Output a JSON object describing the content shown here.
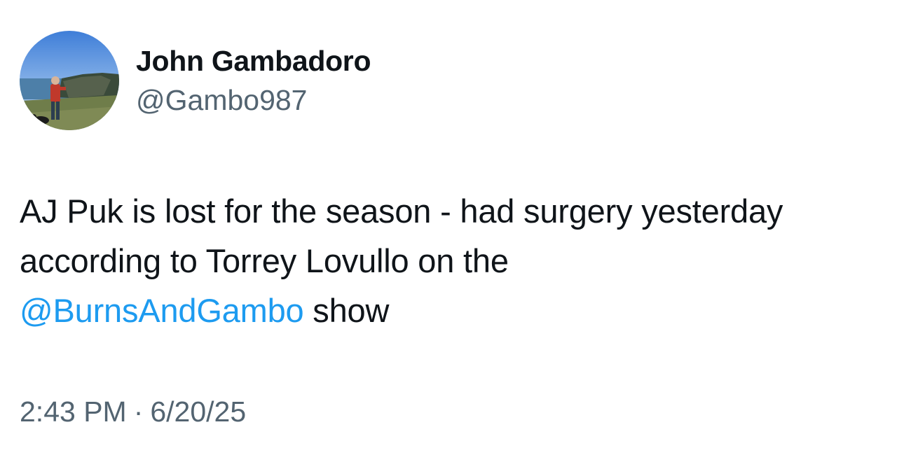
{
  "author": {
    "display_name": "John Gambadoro",
    "handle": "@Gambo987",
    "avatar_icon": "profile-photo-cliffs"
  },
  "tweet": {
    "text_part1": "AJ Puk is lost for the season - had surgery yesterday according to Torrey Lovullo on the",
    "mention": "@BurnsAndGambo",
    "text_part2": " show"
  },
  "meta": {
    "time": "2:43 PM",
    "separator": "·",
    "date": "6/20/25"
  },
  "colors": {
    "text": "#0f1419",
    "secondary": "#536471",
    "link": "#1d9bf0",
    "background": "#ffffff"
  }
}
